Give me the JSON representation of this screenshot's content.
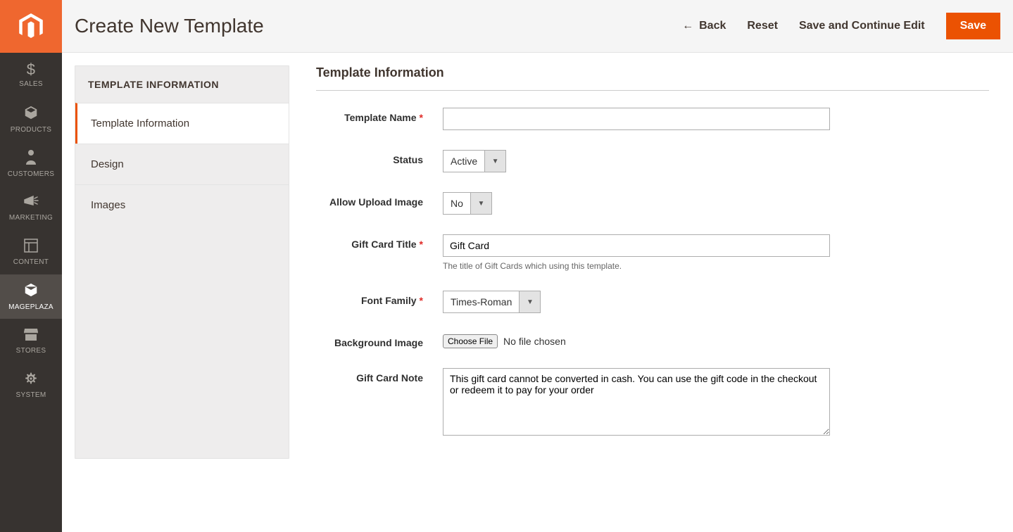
{
  "sidebar": {
    "items": [
      {
        "label": "SALES"
      },
      {
        "label": "PRODUCTS"
      },
      {
        "label": "CUSTOMERS"
      },
      {
        "label": "MARKETING"
      },
      {
        "label": "CONTENT"
      },
      {
        "label": "MAGEPLAZA"
      },
      {
        "label": "STORES"
      },
      {
        "label": "SYSTEM"
      }
    ]
  },
  "header": {
    "title": "Create New Template",
    "back": "Back",
    "reset": "Reset",
    "saveContinue": "Save and Continue Edit",
    "save": "Save"
  },
  "tabs": {
    "title": "TEMPLATE INFORMATION",
    "items": [
      {
        "label": "Template Information"
      },
      {
        "label": "Design"
      },
      {
        "label": "Images"
      }
    ]
  },
  "form": {
    "sectionTitle": "Template Information",
    "templateName": {
      "label": "Template Name",
      "value": ""
    },
    "status": {
      "label": "Status",
      "value": "Active"
    },
    "allowUpload": {
      "label": "Allow Upload Image",
      "value": "No"
    },
    "giftCardTitle": {
      "label": "Gift Card Title",
      "value": "Gift Card",
      "hint": "The title of Gift Cards which using this template."
    },
    "fontFamily": {
      "label": "Font Family",
      "value": "Times-Roman"
    },
    "backgroundImage": {
      "label": "Background Image",
      "button": "Choose File",
      "text": "No file chosen"
    },
    "giftCardNote": {
      "label": "Gift Card Note",
      "value": "This gift card cannot be converted in cash. You can use the gift code in the checkout or redeem it to pay for your order"
    }
  }
}
